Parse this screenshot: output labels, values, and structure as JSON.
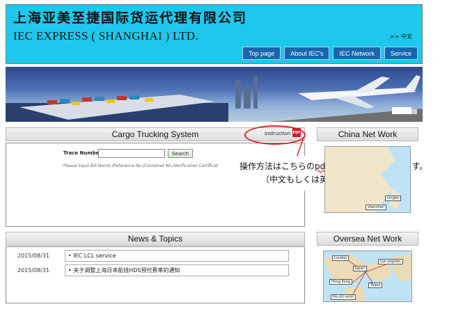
{
  "header": {
    "title_cn": "上海亚美至捷国际货运代理有限公司",
    "title_en": "IEC EXPRESS ( SHANGHAI ) LTD.",
    "lang_link": ">> 中文",
    "nav": [
      "Top page",
      "About IEC's",
      "IEC Network",
      "Service"
    ]
  },
  "tracking": {
    "title": "Cargo Trucking System",
    "instruction_label": "instruction",
    "pdf_badge": "PDF",
    "trace_label": "Trace Number",
    "trace_value": "",
    "search_label": "Search",
    "hint": "Please Input Bill Numb./Reference No./Container No./Verification Certificat"
  },
  "callout": {
    "line1_pre": "操作方法はこちらの",
    "line1_sq": "pdf",
    "line1_post": "にてご確認いただけます。",
    "line2": "（中文もしくは英文のみになります）"
  },
  "news": {
    "title": "News & Topics",
    "items": [
      {
        "date": "2015/08/31",
        "text": "• IEC LCL service"
      },
      {
        "date": "2015/08/31",
        "text": "• 关于调整上海日本航线HDS预付费率的通知"
      }
    ]
  },
  "china_network": {
    "title": "China Net Work",
    "labels": [
      "ningbo",
      "shenzhen"
    ]
  },
  "oversea_network": {
    "title": "Oversea Net Work",
    "labels": [
      "London",
      "Los angeles",
      "Japan",
      "Hong Kong",
      "Taipei",
      "Ho chi minh"
    ]
  },
  "colors": {
    "header_bg": "#1ec8ec",
    "nav_bg": "#1767ad",
    "highlight": "#e02222"
  }
}
